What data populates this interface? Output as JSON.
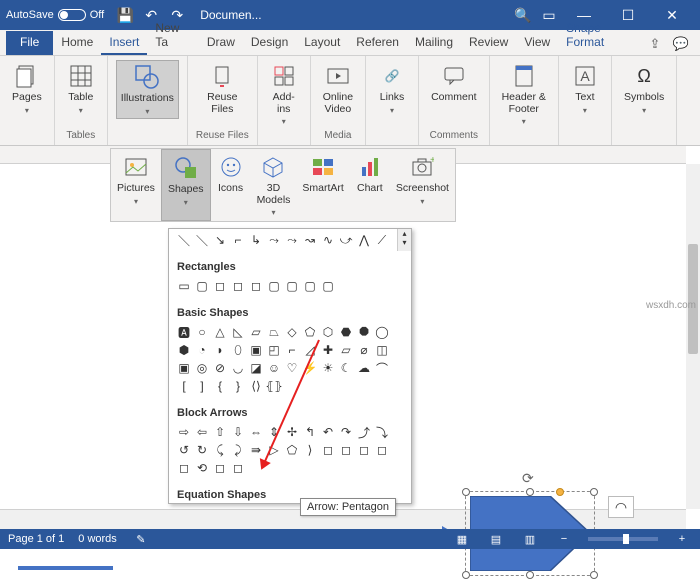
{
  "titlebar": {
    "autosave_label": "AutoSave",
    "autosave_state": "Off",
    "doc_title": "Documen..."
  },
  "tabs": {
    "file": "File",
    "items": [
      "Home",
      "Insert",
      "New Ta",
      "Draw",
      "Design",
      "Layout",
      "Referen",
      "Mailing",
      "Review",
      "View"
    ],
    "context": "Shape Format",
    "active_index": 1
  },
  "ribbon": {
    "groups": [
      {
        "label": "",
        "items": [
          {
            "label": "Pages"
          }
        ]
      },
      {
        "label": "Tables",
        "items": [
          {
            "label": "Table"
          }
        ]
      },
      {
        "label": "",
        "items": [
          {
            "label": "Illustrations"
          }
        ]
      },
      {
        "label": "Reuse Files",
        "items": [
          {
            "label": "Reuse\nFiles"
          }
        ]
      },
      {
        "label": "",
        "items": [
          {
            "label": "Add-\nins"
          }
        ]
      },
      {
        "label": "Media",
        "items": [
          {
            "label": "Online\nVideo"
          }
        ]
      },
      {
        "label": "",
        "items": [
          {
            "label": "Links"
          }
        ]
      },
      {
        "label": "Comments",
        "items": [
          {
            "label": "Comment"
          }
        ]
      },
      {
        "label": "",
        "items": [
          {
            "label": "Header &\nFooter"
          }
        ]
      },
      {
        "label": "",
        "items": [
          {
            "label": "Text"
          }
        ]
      },
      {
        "label": "",
        "items": [
          {
            "label": "Symbols"
          }
        ]
      }
    ]
  },
  "subribbon": {
    "items": [
      "Pictures",
      "Shapes",
      "Icons",
      "3D\nModels",
      "SmartArt",
      "Chart",
      "Screenshot"
    ],
    "selected_index": 1
  },
  "gallery": {
    "sections": [
      {
        "title": "Rectangles"
      },
      {
        "title": "Basic Shapes"
      },
      {
        "title": "Block Arrows"
      },
      {
        "title": "Equation Shapes"
      }
    ],
    "tooltip": "Arrow: Pentagon"
  },
  "statusbar": {
    "page": "Page 1 of 1",
    "words": "0 words",
    "lang_icon": "🖵"
  },
  "colors": {
    "accent": "#2b579a",
    "shape_fill": "#4472c4"
  },
  "watermark": "wsxdh.com"
}
